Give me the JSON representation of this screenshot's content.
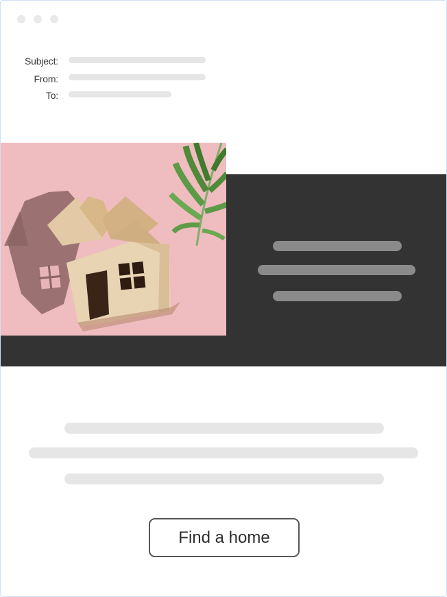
{
  "window": {
    "controls": [
      "close-dot",
      "minimize-dot",
      "zoom-dot"
    ]
  },
  "email_header": {
    "subject_label": "Subject:",
    "from_label": "From:",
    "to_label": "To:"
  },
  "hero": {
    "image": "cardboard-house-with-palm-leaf",
    "background_color": "#efbcc0",
    "band_color": "#333333"
  },
  "cta": {
    "label": "Find a home"
  }
}
